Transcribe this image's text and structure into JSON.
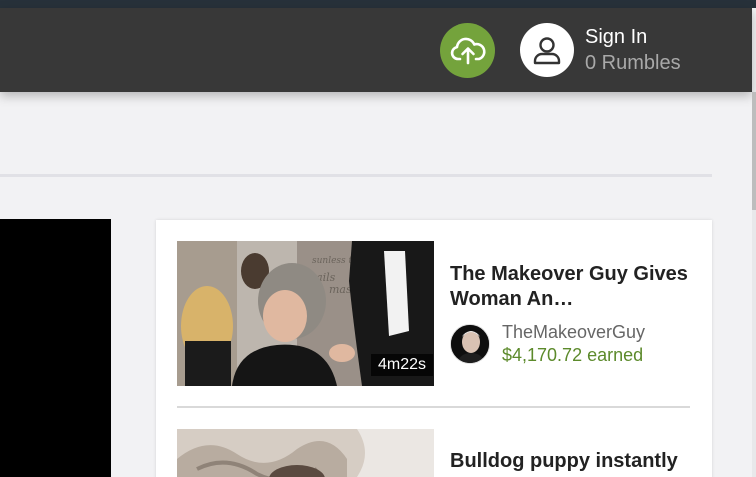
{
  "header": {
    "upload_icon": "cloud-upload-icon",
    "user_icon": "user-icon",
    "sign_in_label": "Sign In",
    "rumbles_label": "0 Rumbles",
    "colors": {
      "upload": "#74a33c",
      "bar": "#383838"
    }
  },
  "feed": {
    "items": [
      {
        "title": "The Makeover Guy Gives Woman An…",
        "duration": "4m22s",
        "channel": "TheMakeoverGuy",
        "earned": "$4,170.72 earned"
      },
      {
        "title": "Bulldog puppy instantly"
      }
    ]
  }
}
